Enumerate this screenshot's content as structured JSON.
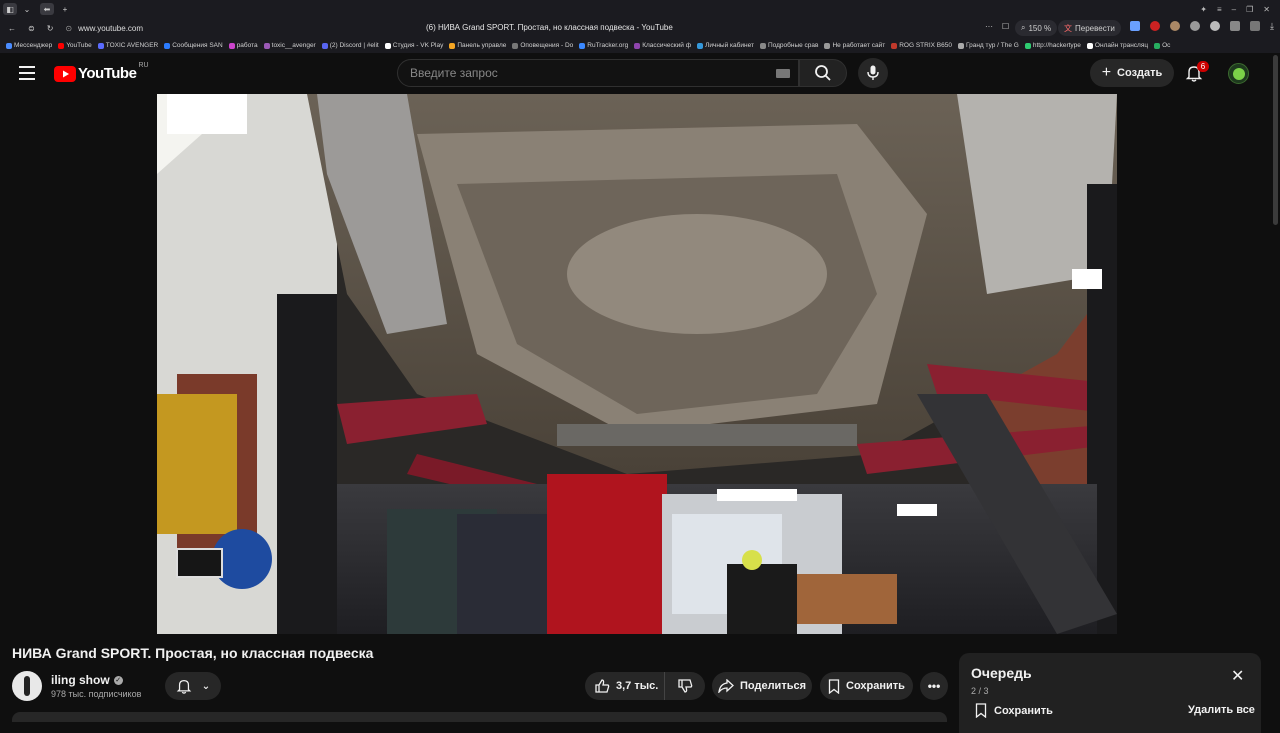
{
  "browser": {
    "url": "www.youtube.com",
    "tab_title": "(6) НИВА Grand SPORT. Простая, но классная подвеска - YouTube",
    "zoom": "150 %",
    "translate_label": "Перевести",
    "bookmarks": [
      "Мессенджер",
      "YouTube",
      "TOXIC AVENGER",
      "Сообщения SAN",
      "работа",
      "toxic__avenger",
      "(2) Discord | #elit",
      "Студия - VK Play",
      "Панель управле",
      "Оповещения - Do",
      "RuTracker.org",
      "Классический ф",
      "Личный кабинет",
      "Подробные срав",
      "Не работает сайт",
      "ROG STRIX B650",
      "Гранд тур / The G",
      "http://hackertype",
      "Онлайн трансляц",
      "Ос"
    ],
    "bookmark_colors": [
      "#4a8cff",
      "#ff0000",
      "#5a6bff",
      "#2b7bff",
      "#cc44cc",
      "#9b59b6",
      "#5865f2",
      "#ffffff",
      "#f5a623",
      "#777777",
      "#3a88ff",
      "#8e44ad",
      "#3498db",
      "#888888",
      "#999999",
      "#c0392b",
      "#aaaaaa",
      "#2ecc71",
      "#ffffff",
      "#27ae60"
    ]
  },
  "header": {
    "logo_text": "YouTube",
    "region": "RU",
    "search_placeholder": "Введите запрос",
    "create_label": "Создать",
    "notifications_count": "6",
    "brand_color": "#ff0000"
  },
  "video": {
    "title": "НИВА Grand SPORT. Простая, но классная подвеска",
    "channel_name": "iling show",
    "subscribers": "978 тыс. подписчиков",
    "likes": "3,7 тыс.",
    "share_label": "Поделиться",
    "save_label": "Сохранить"
  },
  "queue": {
    "title": "Очередь",
    "position": "2 / 3",
    "save_label": "Сохранить",
    "remove_all_label": "Удалить все"
  },
  "icons": {
    "menu": "hamburger-icon",
    "search": "search-icon",
    "mic": "mic-icon",
    "bell": "bell-icon",
    "like": "thumbs-up-icon",
    "dislike": "thumbs-down-icon",
    "share": "share-arrow-icon",
    "save": "bookmark-icon",
    "close": "close-icon"
  }
}
